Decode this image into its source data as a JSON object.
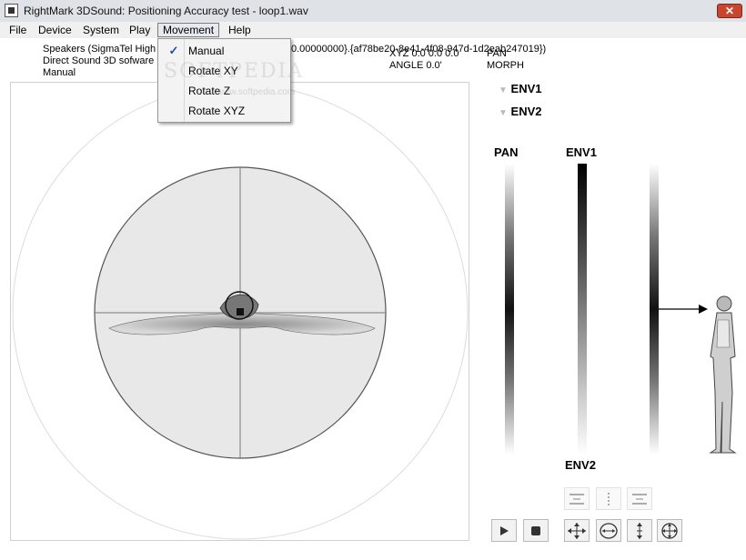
{
  "window": {
    "title": "RightMark 3DSound: Positioning Accuracy test - loop1.wav",
    "close_glyph": "✕"
  },
  "menu": {
    "items": [
      "File",
      "Device",
      "System",
      "Play",
      "Movement",
      "Help"
    ],
    "active": "Movement"
  },
  "movement_menu": {
    "items": [
      {
        "label": "Manual",
        "checked": true
      },
      {
        "label": "Rotate XY",
        "checked": false
      },
      {
        "label": "Rotate Z",
        "checked": false
      },
      {
        "label": "Rotate XYZ",
        "checked": false
      }
    ],
    "check_glyph": "✓"
  },
  "info": {
    "line1_left": "Speakers (SigmaTel High D",
    "line1_right": "0.00000000}.{af78be20-8e41-4f08-947d-1d2eab247019})",
    "line2": "Direct Sound 3D sofware",
    "line3": "Manual",
    "xyz": "XYZ  0.0  0.0  0.0",
    "angle": "ANGLE  0.0'",
    "pan": "PAN",
    "morph": "MORPH"
  },
  "watermark": {
    "text": "SOFTPEDIA",
    "sub": "www.softpedia.com"
  },
  "env": {
    "env1": "ENV1",
    "env2": "ENV2",
    "marker": "▼"
  },
  "bars": {
    "pan_label": "PAN",
    "env1_label": "ENV1",
    "env2_label": "ENV2"
  },
  "icons": {
    "align_top": "align-top-icon",
    "align_middle": "align-middle-icon",
    "align_bottom": "align-bottom-icon",
    "play": "play-icon",
    "stop": "stop-icon",
    "move_xy": "move-xy-icon",
    "rotate_xy": "rotate-xy-icon",
    "move_z": "move-z-icon",
    "rotate_xyz": "rotate-xyz-icon"
  },
  "colors": {
    "accent": "#1f4fb0",
    "close": "#c84530"
  }
}
